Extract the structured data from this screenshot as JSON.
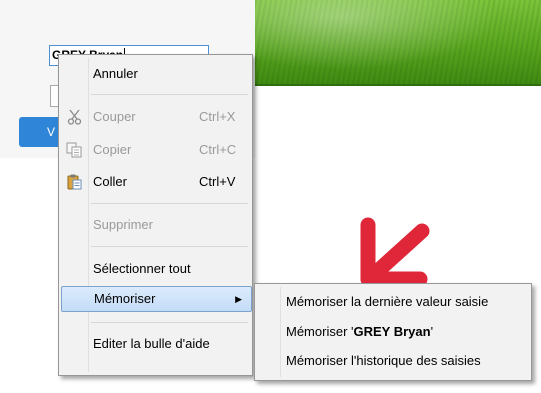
{
  "background": {
    "input_value": "GREY Bryan",
    "button_label": "V"
  },
  "menu": {
    "undo": "Annuler",
    "cut": {
      "label": "Couper",
      "shortcut": "Ctrl+X"
    },
    "copy": {
      "label": "Copier",
      "shortcut": "Ctrl+C"
    },
    "paste": {
      "label": "Coller",
      "shortcut": "Ctrl+V"
    },
    "delete": "Supprimer",
    "select_all": "Sélectionner tout",
    "memorize": "Mémoriser",
    "edit_tooltip": "Editer la bulle d'aide"
  },
  "submenu": {
    "last_value": "Mémoriser la dernière valeur saisie",
    "current_prefix": "Mémoriser '",
    "current_value": "GREY Bryan",
    "current_suffix": "'",
    "history": "Mémoriser l'historique des saisies"
  },
  "colors": {
    "highlight": "#c4dcf7",
    "annotation_arrow": "#e0273a",
    "accent_button": "#2f86d8"
  }
}
